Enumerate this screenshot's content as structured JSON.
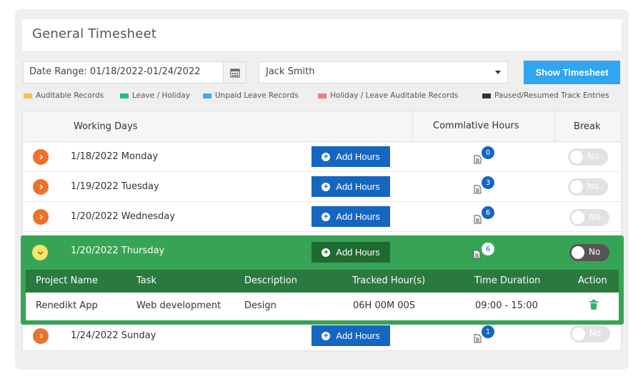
{
  "title": "General Timesheet",
  "filters": {
    "date_range": "Date Range: 01/18/2022-01/24/2022",
    "user": "Jack Smith",
    "show_button": "Show Timesheet"
  },
  "legend": [
    {
      "label": "Auditable Records",
      "color": "#f7c04a"
    },
    {
      "label": "Leave / Holiday",
      "color": "#1fbf86"
    },
    {
      "label": "Unpaid Leave Records",
      "color": "#45a8ef"
    },
    {
      "label": "Holiday / Leave Auditable Records",
      "color": "#f27b7b"
    },
    {
      "label": "Paused/Resumed Track Entries",
      "color": "#333333"
    }
  ],
  "table": {
    "headers": [
      "Working Days",
      "Commlative Hours",
      "Break"
    ],
    "add_label": "Add Hours",
    "toggle_label": "No",
    "rows": [
      {
        "date": "1/18/2022 Monday",
        "count": "0"
      },
      {
        "date": "1/19/2022 Tuesday",
        "count": "3"
      },
      {
        "date": "1/20/2022 Wednesday",
        "count": "6"
      }
    ],
    "expanded_row": {
      "date": "1/20/2022 Thursday",
      "count": "6",
      "sub_headers": [
        "Project Name",
        "Task",
        "Description",
        "Tracked Hour(s)",
        "Time Duration",
        "Action"
      ],
      "entries": [
        {
          "project": "Renedikt App",
          "task": "Web development",
          "description": "Design",
          "tracked": "06H 00M 00S",
          "duration": "09:00 - 15:00"
        }
      ]
    },
    "last_row": {
      "date": "1/24/2022 Sunday",
      "count": "1"
    }
  }
}
